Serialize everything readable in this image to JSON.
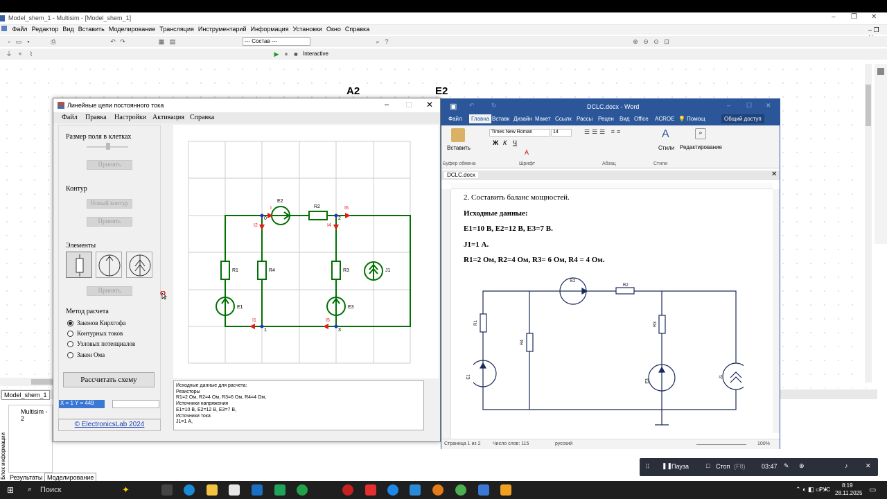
{
  "multisim": {
    "title": "Model_shem_1 - Multisim - [Model_shem_1]",
    "menu": [
      "Файл",
      "Редактор",
      "Вид",
      "Вставить",
      "Моделирование",
      "Трансляция",
      "Инструментарий",
      "Информация",
      "Установки",
      "Окно",
      "Справка"
    ],
    "dropdown": "--- Состав ---",
    "interactive": "Interactive",
    "tab_doc": "Model_shem_1",
    "bottom_label": "Multisim  -  2",
    "bottom_tabs": [
      "Результаты",
      "Моделирование"
    ],
    "side_label": "Блок информации",
    "canvas_labels": [
      "A2",
      "E2"
    ]
  },
  "app": {
    "title": "Линейные цепи постоянного тока",
    "menu": [
      "Файл",
      "Правка",
      "Настройки",
      "Активация",
      "Справка"
    ],
    "grid_title": "Размер поля в клетках",
    "apply": "Принять",
    "contour_title": "Контур",
    "new_contour": "Новый контур",
    "elements_title": "Элементы",
    "method_title": "Метод расчета",
    "methods": [
      "Законов Кирхгофа",
      "Контурных токов",
      "Узловых потенциалов",
      "Закон Ома"
    ],
    "calc_button": "Рассчитать схему",
    "coords": "X = 1  Y = 449",
    "link": "© ElectronicsLab 2024",
    "output": [
      "Исходные данные для расчета:",
      "Резисторы",
      "R1=2 Ом, R2=4 Ом, R3=6 Ом, R4=4 Ом,",
      "Источники напряжения",
      "E1=10 В, E2=12 В, E3=7 В,",
      "Источники тока",
      "J1=1 А,"
    ],
    "circuit_labels": {
      "E1": "E1",
      "E2": "E2",
      "E3": "E3",
      "J1": "J1",
      "R1": "R1",
      "R2": "R2",
      "R3": "R3",
      "R4": "R4",
      "I1": "I1",
      "I2": "I2",
      "I4": "I4",
      "I5": "I5",
      "I6": "I6",
      "n0": "0",
      "n1": "1",
      "n2": "2",
      "n3": "3",
      "i_top": "I"
    }
  },
  "word": {
    "title": "DCLC.docx - Word",
    "tabs": [
      "Файл",
      "Главна",
      "Вставк",
      "Дизайн",
      "Макет",
      "Ссылк",
      "Рассы",
      "Рецен",
      "Вид",
      "Office",
      "ACROE"
    ],
    "help": "Помощ",
    "share": "Общий доступ",
    "paste": "Вставить",
    "font": "Times New Roman",
    "size": "14",
    "styles": "Стили",
    "editing": "Редактирование",
    "groups": [
      "Буфер обмена",
      "Шрифт",
      "Абзац",
      "Стили"
    ],
    "doc_tab": "DCLC.docx",
    "lines": [
      "2. Составить баланс мощностей.",
      "Исходные данные:",
      "E1=10 В, E2=12 В, E3=7 В.",
      "J1=1 А.",
      "R1=2 Ом, R2=4 Ом, R3= 6 Ом, R4 = 4 Ом."
    ],
    "status": {
      "page": "Страница 1 из 2",
      "words": "Число слов: 115",
      "lang": "русский",
      "zoom": "100%"
    },
    "diagram": {
      "E2": "E2",
      "R2": "R2",
      "R1": "R1",
      "R4": "R4",
      "R3": "R3",
      "E1": "E1",
      "E3": "E3",
      "J1": "J1"
    }
  },
  "recorder": {
    "pause": "Пауза",
    "stop": "Стоп",
    "stop_key": "(F8)",
    "time": "03:47"
  },
  "taskbar": {
    "search": "Поиск",
    "lang": "РУС",
    "time": "8:19",
    "date": "28.11.2025"
  }
}
